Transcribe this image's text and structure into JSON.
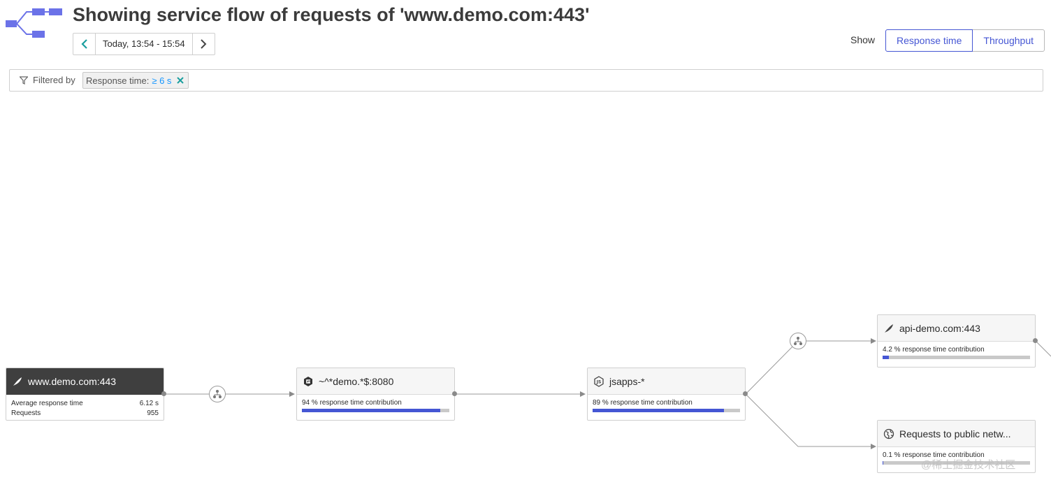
{
  "header": {
    "title": "Showing service flow of requests of 'www.demo.com:443'",
    "timeframe": "Today, 13:54 - 15:54",
    "show_label": "Show",
    "show_options": [
      "Response time",
      "Throughput"
    ],
    "selected_show_option": "Response time"
  },
  "filter": {
    "label": "Filtered by",
    "chip_key": "Response time:",
    "chip_value": "≥ 6 s"
  },
  "nodes": {
    "origin": {
      "name": "www.demo.com:443",
      "avg_response_label": "Average response time",
      "avg_response_value": "6.12 s",
      "requests_label": "Requests",
      "requests_value": "955"
    },
    "demo8080": {
      "name": "~^*demo.*$:8080",
      "contribution_text": "94 % response time contribution",
      "contribution_pct": 94
    },
    "jsapps": {
      "name": "jsapps-*",
      "contribution_text": "89 % response time contribution",
      "contribution_pct": 89
    },
    "api_demo": {
      "name": "api-demo.com:443",
      "contribution_text": "4.2 % response time contribution",
      "contribution_pct": 4.2
    },
    "public_network": {
      "name": "Requests to public netw...",
      "contribution_text": "0.1 % response time contribution",
      "contribution_pct": 0.1
    }
  },
  "watermark": "@稀土掘金技术社区",
  "colors": {
    "accent": "#4556d4",
    "selected_node": "#3f3f3f",
    "filter_value": "#1496ff",
    "bar_track": "#c9c9c9"
  }
}
